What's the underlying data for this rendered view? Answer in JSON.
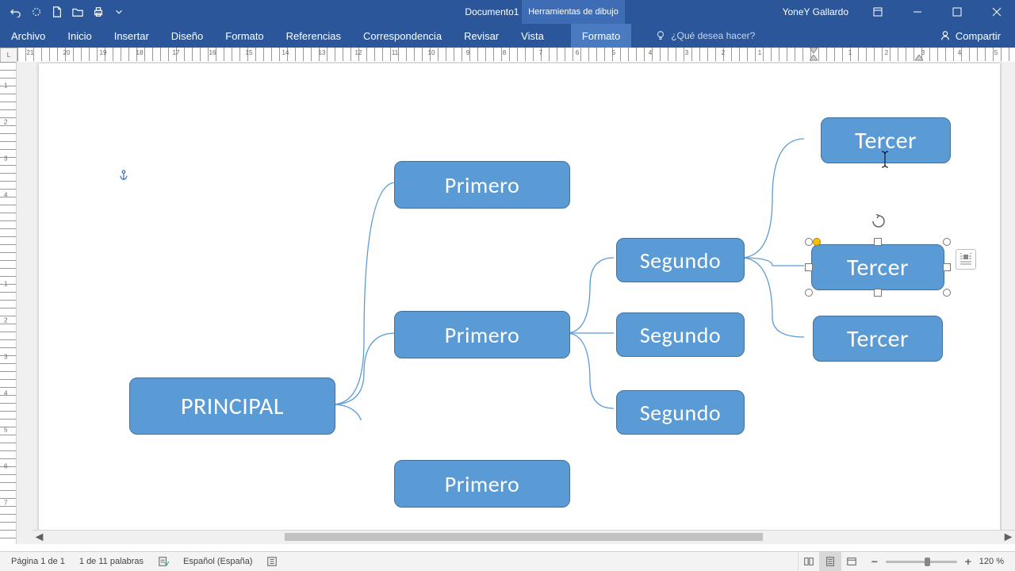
{
  "titlebar": {
    "doc_title": "Documento1 - Word",
    "context_tab": "Herramientas de dibujo",
    "username": "YoneY Gallardo"
  },
  "ribbon": {
    "tabs": [
      "Archivo",
      "Inicio",
      "Insertar",
      "Diseño",
      "Formato",
      "Referencias",
      "Correspondencia",
      "Revisar",
      "Vista"
    ],
    "context_tab": "Formato",
    "tell_me_placeholder": "¿Qué desea hacer?",
    "share": "Compartir"
  },
  "hruler": {
    "corner": "L",
    "numbers": [
      21,
      20,
      19,
      18,
      17,
      16,
      15,
      14,
      13,
      12,
      11,
      10,
      9,
      8,
      7,
      6,
      5,
      4,
      3,
      2,
      1,
      1,
      2,
      3,
      4,
      5
    ]
  },
  "vruler": {
    "numbers": [
      1,
      2,
      3,
      4,
      1,
      2,
      3,
      4,
      5,
      6,
      7
    ]
  },
  "shapes": {
    "principal": "PRINCIPAL",
    "primero": "Primero",
    "segundo": "Segundo",
    "tercer": "Tercer"
  },
  "status": {
    "page": "Página 1 de 1",
    "words": "1 de 11 palabras",
    "lang": "Español (España)",
    "zoom": "120 %"
  }
}
